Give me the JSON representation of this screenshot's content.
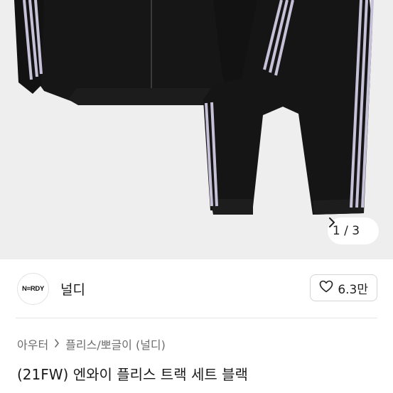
{
  "gallery": {
    "counter_text": "1 / 3",
    "image_icon": "track-suit-product-photo"
  },
  "seller": {
    "avatar_text": "N≡RDY",
    "name": "널디",
    "like_count": "6.3만"
  },
  "breadcrumb": {
    "items": [
      "아우터",
      "플리스/뽀글이 (널디)"
    ]
  },
  "product": {
    "title": "(21FW) 엔와이 플리스 트랙 세트 블랙"
  },
  "colors": {
    "background": "#ffffff",
    "gallery_bg": "#eeeeee",
    "garment": "#141414",
    "stripe": "#c7c1d8"
  }
}
